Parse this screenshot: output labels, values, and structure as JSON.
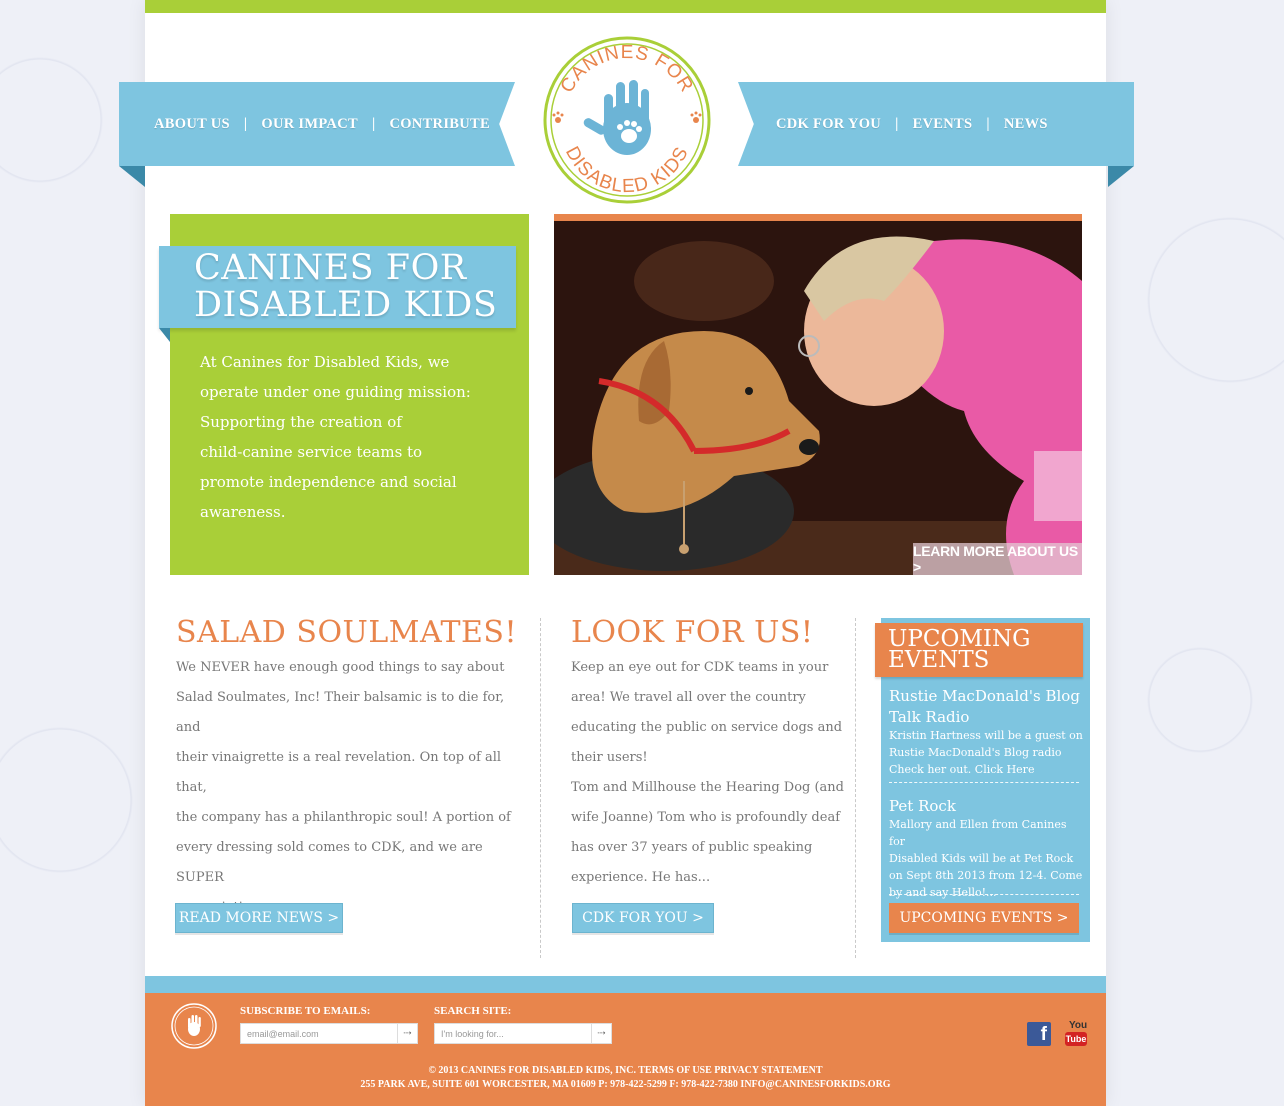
{
  "nav": {
    "left": [
      "ABOUT US",
      "OUR IMPACT",
      "CONTRIBUTE"
    ],
    "right": [
      "CDK FOR YOU",
      "EVENTS",
      "NEWS"
    ],
    "separator": "|"
  },
  "logo": {
    "top_text": "CANINES FOR",
    "bottom_text": "DISABLED KIDS"
  },
  "hero": {
    "title_line1": "CANINES FOR",
    "title_line2": "DISABLED KIDS",
    "text_lines": [
      "At Canines for Disabled Kids, we",
      "operate under one guiding mission:",
      "Supporting the creation of",
      "child-canine  service teams to",
      "promote independence and social",
      "awareness."
    ],
    "learn_more": "LEARN MORE ABOUT US >"
  },
  "col1": {
    "title": "SALAD SOULMATES!",
    "lines": [
      "We NEVER have enough good things to say about",
      "Salad Soulmates, Inc! Their balsamic is to die for, and",
      "their vinaigrette is a real revelation. On top of all that,",
      "the company has a philanthropic soul! A portion of",
      "every dressing sold comes to CDK, and we are SUPER",
      "appreciative..."
    ],
    "button": "READ MORE NEWS >"
  },
  "col2": {
    "title": "LOOK FOR US!",
    "lines": [
      "Keep an eye out for CDK teams in your",
      "area! We travel all over the country",
      "educating the public on service dogs and",
      "their users!",
      "Tom and Millhouse the Hearing Dog (and",
      "wife Joanne) Tom who is profoundly deaf",
      "has over 37 years of public speaking",
      "experience. He has..."
    ],
    "button": "CDK FOR YOU >"
  },
  "events": {
    "heading_line1": "UPCOMING",
    "heading_line2": "EVENTS",
    "items": [
      {
        "title_lines": [
          "Rustie MacDonald's Blog",
          "Talk Radio"
        ],
        "text_lines": [
          "Kristin Hartness will be a guest on",
          "Rustie MacDonald's Blog radio",
          "Check her out. Click Here"
        ]
      },
      {
        "title_lines": [
          "Pet Rock"
        ],
        "text_lines": [
          "Mallory and Ellen from Canines for",
          "Disabled Kids will be at Pet Rock",
          "on Sept 8th 2013 from 12-4. Come",
          "by and say Hello!..."
        ]
      }
    ],
    "button": "UPCOMING EVENTS >"
  },
  "footer": {
    "subscribe_label": "SUBSCRIBE TO EMAILS:",
    "subscribe_placeholder": "email@email.com",
    "search_label": "SEARCH SITE:",
    "search_placeholder": "I'm looking for...",
    "go_glyph": "⇢",
    "copyright": "© 2013 CANINES FOR DISABLED KIDS, INC. TERMS OF USE PRIVACY STATEMENT",
    "address": "255 PARK AVE, SUITE 601 WORCESTER, MA 01609 P: 978-422-5299 F: 978-422-7380 INFO@CANINESFORKIDS.ORG",
    "facebook": "f",
    "youtube_top": "You",
    "youtube_bottom": "Tube"
  },
  "colors": {
    "green": "#a9cf38",
    "blue": "#7ec5e0",
    "orange": "#e8854c"
  },
  "icons": [
    "paw-icon",
    "handprint-icon",
    "facebook-icon",
    "youtube-icon",
    "arrow-icon"
  ]
}
